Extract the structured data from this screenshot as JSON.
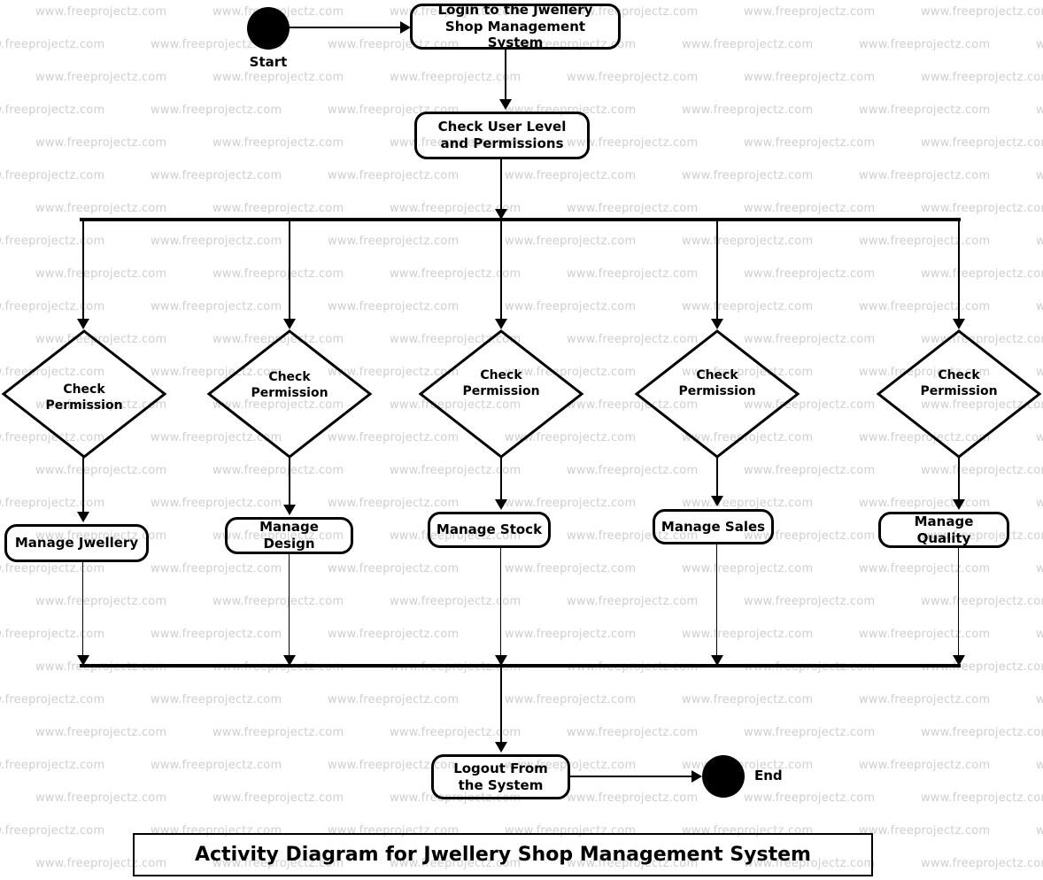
{
  "diagram": {
    "caption": "Activity Diagram for Jwellery Shop Management System",
    "start_label": "Start",
    "end_label": "End",
    "watermark_text": "www.freeprojectz.com",
    "colors": {
      "stroke": "#000000",
      "background": "#ffffff",
      "watermark": "#cfcfcf"
    },
    "activities": [
      {
        "id": "login",
        "label": "Login to the Jwellery Shop Management System"
      },
      {
        "id": "check-user-level",
        "label": "Check User Level and Permissions"
      },
      {
        "id": "logout",
        "label": "Logout From the System"
      }
    ],
    "decisions": [
      {
        "id": "check-permission-1",
        "label": "Check Permission"
      },
      {
        "id": "check-permission-2",
        "label": "Check Permission"
      },
      {
        "id": "check-permission-3",
        "label": "Check Permission"
      },
      {
        "id": "check-permission-4",
        "label": "Check Permission"
      },
      {
        "id": "check-permission-5",
        "label": "Check Permission"
      }
    ],
    "branch_activities": [
      {
        "id": "manage-jwellery",
        "label": "Manage Jwellery"
      },
      {
        "id": "manage-design",
        "label": "Manage Design"
      },
      {
        "id": "manage-stock",
        "label": "Manage Stock"
      },
      {
        "id": "manage-sales",
        "label": "Manage Sales"
      },
      {
        "id": "manage-quality",
        "label": "Manage Quality"
      }
    ]
  }
}
